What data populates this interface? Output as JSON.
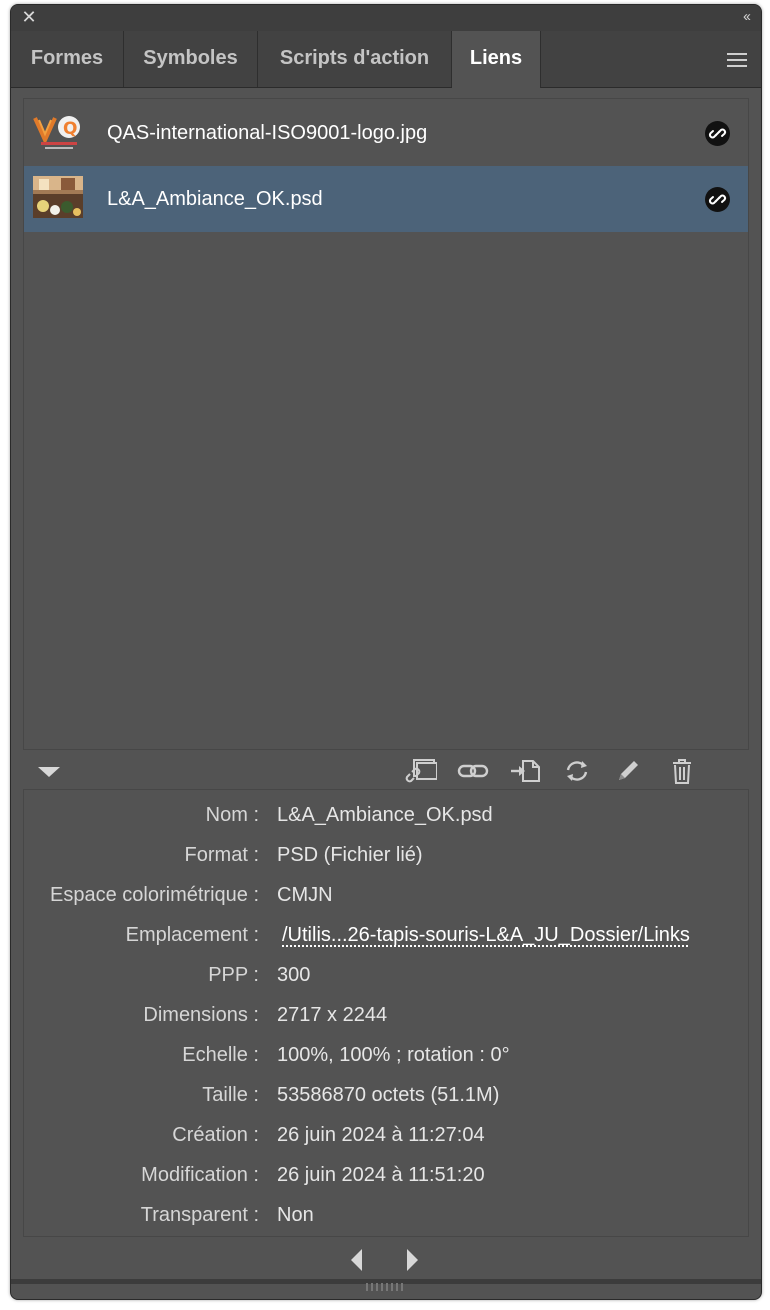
{
  "window": {
    "close_glyph": "✕",
    "collapse_glyph": "‹‹"
  },
  "tabs": [
    {
      "label": "Formes",
      "active": false
    },
    {
      "label": "Symboles",
      "active": false
    },
    {
      "label": "Scripts d'action",
      "active": false
    },
    {
      "label": "Liens",
      "active": true
    }
  ],
  "links": [
    {
      "name": "QAS-international-ISO9001-logo.jpg",
      "selected": false,
      "status_icon": "link-icon"
    },
    {
      "name": "L&A_Ambiance_OK.psd",
      "selected": true,
      "status_icon": "link-icon"
    }
  ],
  "toolbar": {
    "buttons": [
      "relink-from-library-icon",
      "relink-icon",
      "go-to-link-icon",
      "update-link-icon",
      "edit-original-icon",
      "delete-icon"
    ]
  },
  "info": {
    "rows": [
      {
        "label": "Nom :",
        "value": "L&A_Ambiance_OK.psd"
      },
      {
        "label": "Format :",
        "value": "PSD (Fichier lié)"
      },
      {
        "label": "Espace colorimétrique :",
        "value": "CMJN"
      },
      {
        "label": "Emplacement :",
        "value": "/Utilis...26-tapis-souris-L&A_JU_Dossier/Links"
      },
      {
        "label": "PPP :",
        "value": "300"
      },
      {
        "label": "Dimensions :",
        "value": "2717 x 2244"
      },
      {
        "label": "Echelle :",
        "value": "100%, 100% ; rotation : 0°"
      },
      {
        "label": "Taille :",
        "value": "53586870 octets (51.1M)"
      },
      {
        "label": "Création :",
        "value": "26 juin 2024 à 11:27:04"
      },
      {
        "label": "Modification :",
        "value": "26 juin 2024 à 11:51:20"
      },
      {
        "label": "Transparent :",
        "value": "Non"
      }
    ]
  },
  "colors": {
    "panel_bg": "#535353",
    "selected_row": "#4c6379",
    "tab_bar": "#424242"
  }
}
